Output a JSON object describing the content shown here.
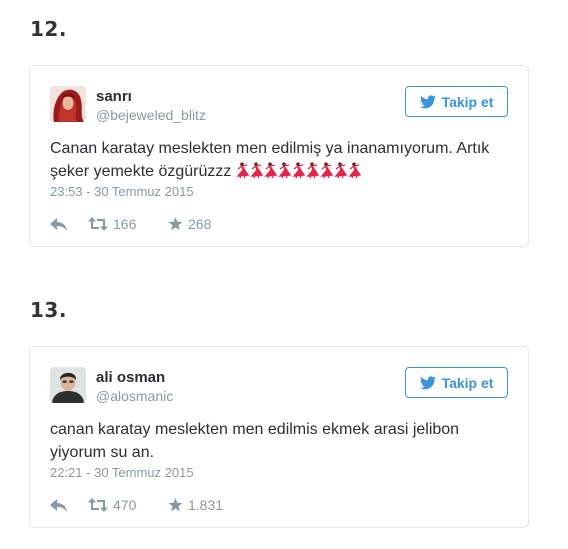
{
  "colors": {
    "twitter_blue": "#3b94d9",
    "text": "#292f33",
    "muted": "#8899a6",
    "border": "#e1e8ed",
    "dancer": "#e8234a"
  },
  "items": [
    {
      "number": "12.",
      "tweet": {
        "avatar": "profile-photo-red-hair",
        "name": "sanrı",
        "handle": "@bejeweled_blitz",
        "follow_label": "Takip et",
        "text": "Canan karatay meslekten men edilmiş ya inanamıyorum. Artık şeker yemekte özgürüzzz",
        "emoji": "dancer-emoji",
        "emoji_count": 9,
        "timestamp": "23:53 - 30 Temmuz 2015",
        "retweets": "166",
        "likes": "268",
        "icons": [
          "reply-icon",
          "retweet-icon",
          "star-icon",
          "twitter-bird-icon"
        ]
      }
    },
    {
      "number": "13.",
      "tweet": {
        "avatar": "profile-photo-young-man",
        "name": "ali osman",
        "handle": "@alosmanic",
        "follow_label": "Takip et",
        "text": "canan karatay meslekten men edilmis ekmek arasi jelibon yiyorum su an.",
        "timestamp": "22:21 - 30 Temmuz 2015",
        "retweets": "470",
        "likes": "1.831",
        "icons": [
          "reply-icon",
          "retweet-icon",
          "star-icon",
          "twitter-bird-icon"
        ]
      }
    }
  ]
}
